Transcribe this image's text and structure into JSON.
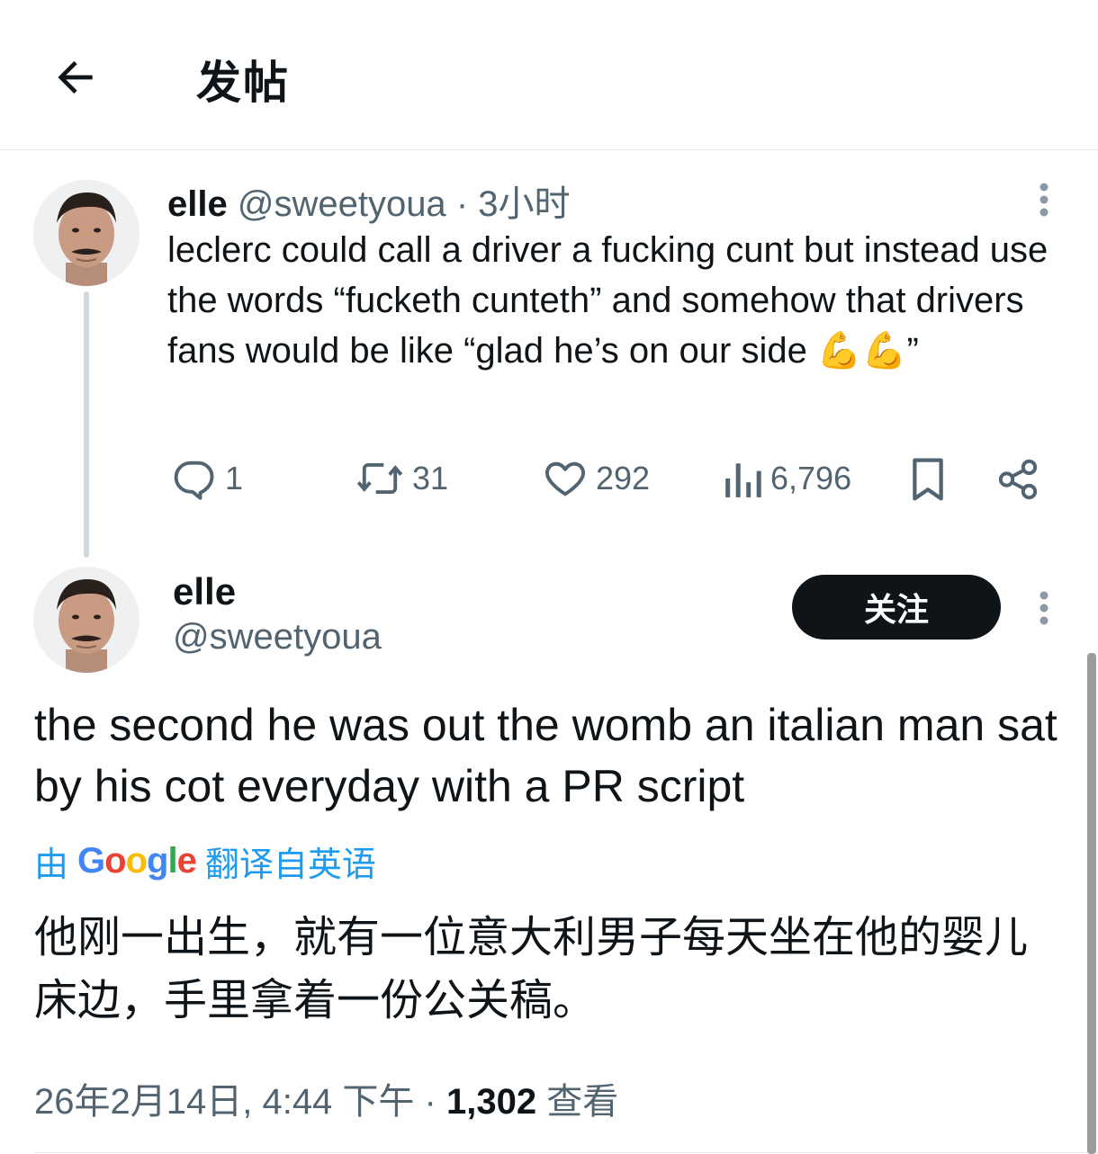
{
  "header": {
    "title": "发帖"
  },
  "parent_tweet": {
    "name": "elle",
    "handle": "@sweetyoua",
    "separator": "·",
    "time": "3小时",
    "text": "leclerc could call a driver a fucking cunt but instead use the words “fucketh cunteth” and somehow that drivers fans would be like “glad he’s on our side 💪💪”",
    "actions": {
      "replies": "1",
      "reposts": "31",
      "likes": "292",
      "views": "6,796"
    }
  },
  "main_tweet": {
    "name": "elle",
    "handle": "@sweetyoua",
    "follow_label": "关注",
    "text": "the second he was out the womb an italian man sat by his cot everyday with a PR script",
    "translation": {
      "prefix": "由",
      "provider": "Google",
      "suffix": "翻译自英语"
    },
    "translated_text": "他刚一出生，就有一位意大利男子每天坐在他的婴儿床边，手里拿着一份公关稿。",
    "timestamp": "26年2月14日, 4:44 下午",
    "separator": "·",
    "views_count": "1,302",
    "views_label": "查看"
  },
  "icons": [
    "back-arrow-icon",
    "more-icon",
    "reply-icon",
    "repost-icon",
    "like-icon",
    "views-icon",
    "bookmark-icon",
    "share-icon"
  ],
  "colors": {
    "text": "#0f1419",
    "muted": "#536471",
    "link": "#1d9bf0",
    "follow_bg": "#0f1419",
    "thread_line": "#cfd9de"
  }
}
